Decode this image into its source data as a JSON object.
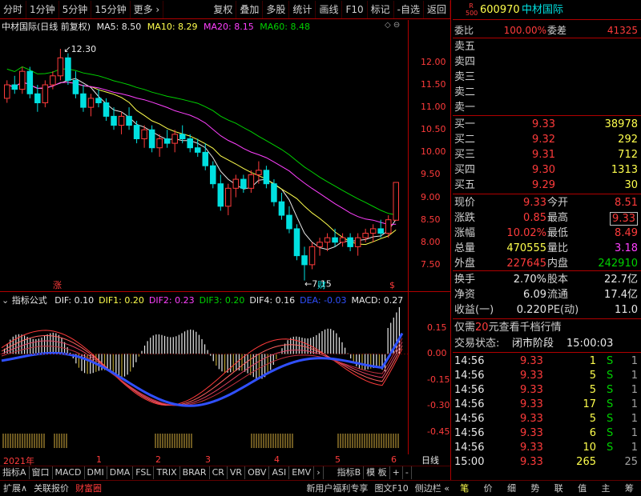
{
  "toolbar": {
    "left_items": [
      "分时",
      "1分钟",
      "5分钟",
      "15分钟",
      "更多 ›"
    ],
    "right_items": [
      "复权",
      "叠加",
      "多股",
      "统计",
      "画线",
      "F10",
      "标记",
      "-自选",
      "返回"
    ]
  },
  "chart": {
    "stock_label": "中材国际(日线 前复权)",
    "ma_legend": [
      {
        "label": "MA5: 8.50",
        "color": "#e8e8e8"
      },
      {
        "label": "MA10: 8.29",
        "color": "#ffff4d"
      },
      {
        "label": "MA20: 8.15",
        "color": "#ff40ff"
      },
      {
        "label": "MA60: 8.48",
        "color": "#00d200"
      }
    ],
    "high_label": "12.30",
    "low_label": "7.15",
    "price_ticks": [
      "12.00",
      "11.50",
      "11.00",
      "10.50",
      "10.00",
      "9.50",
      "9.00",
      "8.50",
      "8.00",
      "7.50"
    ],
    "markers": [
      "涨",
      "财",
      "$"
    ],
    "candles": [
      [
        11.2,
        11.6,
        11.1,
        11.5
      ],
      [
        11.5,
        11.7,
        11.3,
        11.4
      ],
      [
        11.4,
        11.9,
        11.3,
        11.8
      ],
      [
        11.8,
        11.9,
        11.2,
        11.3
      ],
      [
        11.3,
        11.5,
        10.9,
        11.1
      ],
      [
        11.1,
        11.6,
        11.0,
        11.5
      ],
      [
        11.5,
        11.8,
        11.4,
        11.7
      ],
      [
        11.7,
        12.3,
        11.6,
        12.1
      ],
      [
        12.1,
        12.2,
        11.5,
        11.6
      ],
      [
        11.6,
        11.8,
        11.2,
        11.3
      ],
      [
        11.3,
        11.5,
        10.9,
        11.0
      ],
      [
        11.0,
        11.3,
        10.8,
        11.2
      ],
      [
        11.2,
        11.4,
        11.0,
        11.1
      ],
      [
        11.1,
        11.2,
        10.7,
        10.8
      ],
      [
        10.8,
        11.0,
        10.5,
        10.6
      ],
      [
        10.6,
        10.9,
        10.4,
        10.8
      ],
      [
        10.8,
        11.0,
        10.5,
        10.6
      ],
      [
        10.6,
        10.7,
        10.2,
        10.3
      ],
      [
        10.3,
        10.6,
        10.1,
        10.5
      ],
      [
        10.5,
        10.6,
        10.0,
        10.1
      ],
      [
        10.1,
        10.4,
        9.9,
        10.3
      ],
      [
        10.3,
        10.5,
        10.1,
        10.2
      ],
      [
        10.2,
        10.5,
        10.0,
        10.4
      ],
      [
        10.4,
        10.6,
        10.2,
        10.3
      ],
      [
        10.3,
        10.4,
        10.0,
        10.1
      ],
      [
        10.1,
        10.3,
        9.9,
        10.0
      ],
      [
        10.0,
        10.2,
        9.6,
        9.7
      ],
      [
        9.7,
        9.8,
        9.2,
        9.3
      ],
      [
        9.3,
        9.5,
        8.7,
        8.8
      ],
      [
        8.8,
        9.3,
        8.6,
        9.2
      ],
      [
        9.2,
        9.5,
        9.0,
        9.4
      ],
      [
        9.4,
        9.5,
        9.1,
        9.2
      ],
      [
        9.2,
        9.6,
        9.1,
        9.5
      ],
      [
        9.5,
        9.8,
        9.3,
        9.6
      ],
      [
        9.6,
        9.7,
        9.2,
        9.3
      ],
      [
        9.3,
        9.4,
        8.8,
        8.9
      ],
      [
        8.9,
        9.1,
        8.5,
        8.6
      ],
      [
        8.6,
        8.8,
        8.2,
        8.3
      ],
      [
        8.3,
        8.4,
        7.6,
        7.7
      ],
      [
        7.7,
        7.9,
        7.15,
        7.5
      ],
      [
        7.5,
        8.0,
        7.4,
        7.9
      ],
      [
        7.9,
        8.1,
        7.7,
        8.0
      ],
      [
        8.0,
        8.2,
        7.8,
        8.1
      ],
      [
        8.1,
        8.3,
        7.9,
        8.0
      ],
      [
        8.0,
        8.2,
        7.9,
        8.1
      ],
      [
        8.1,
        8.2,
        7.8,
        7.9
      ],
      [
        7.9,
        8.2,
        7.7,
        8.1
      ],
      [
        8.1,
        8.3,
        8.0,
        8.2
      ],
      [
        8.2,
        8.4,
        8.0,
        8.3
      ],
      [
        8.3,
        8.5,
        8.1,
        8.2
      ],
      [
        8.2,
        8.6,
        8.1,
        8.5
      ],
      [
        8.49,
        9.33,
        8.49,
        9.33
      ]
    ],
    "indicator_label": "指标公式",
    "indicator_legend": [
      {
        "label": "DIF: 0.10",
        "color": "#e8e8e8"
      },
      {
        "label": "DIF1: 0.20",
        "color": "#ffff4d"
      },
      {
        "label": "DIF2: 0.23",
        "color": "#ff40ff"
      },
      {
        "label": "DIF3: 0.20",
        "color": "#00d200"
      },
      {
        "label": "DIF4: 0.16",
        "color": "#e8e8e8"
      },
      {
        "label": "DEA: -0.03",
        "color": "#3050ff"
      },
      {
        "label": "MACD: 0.27",
        "color": "#e8e8e8"
      }
    ],
    "indicator_ticks": [
      "0.15",
      "0.00",
      "-0.15",
      "-0.30",
      "-0.45"
    ],
    "date_labels": [
      "2021年",
      "1",
      "2",
      "3",
      "4",
      "5",
      "6"
    ],
    "period_label": "日线"
  },
  "indicator_tabs": [
    "指标A",
    "窗口",
    "MACD",
    "DMI",
    "DMA",
    "FSL",
    "TRIX",
    "BRAR",
    "CR",
    "VR",
    "OBV",
    "ASI",
    "EMV",
    "›",
    "指标B",
    "模 板",
    "+",
    "-"
  ],
  "bottom_bar": {
    "left": [
      "扩展∧",
      "关联报价",
      "财富圈"
    ],
    "right": [
      "新用户福利专享",
      "图文F10",
      "侧边栏 «"
    ],
    "tabs": [
      "笔",
      "价",
      "细",
      "势",
      "联",
      "值",
      "主",
      "筹"
    ]
  },
  "quote": {
    "code_badge": "R 500",
    "code": "600970",
    "name": "中材国际",
    "weibi_label": "委比",
    "weibi": "100.00%",
    "weicha_label": "委差",
    "weicha": "41325",
    "sell": [
      {
        "label": "卖五",
        "price": "",
        "vol": ""
      },
      {
        "label": "卖四",
        "price": "",
        "vol": ""
      },
      {
        "label": "卖三",
        "price": "",
        "vol": ""
      },
      {
        "label": "卖二",
        "price": "",
        "vol": ""
      },
      {
        "label": "卖一",
        "price": "",
        "vol": ""
      }
    ],
    "buy": [
      {
        "label": "买一",
        "price": "9.33",
        "vol": "38978"
      },
      {
        "label": "买二",
        "price": "9.32",
        "vol": "292"
      },
      {
        "label": "买三",
        "price": "9.31",
        "vol": "712"
      },
      {
        "label": "买四",
        "price": "9.30",
        "vol": "1313"
      },
      {
        "label": "买五",
        "price": "9.29",
        "vol": "30"
      }
    ],
    "stats": [
      {
        "l1": "现价",
        "v1": "9.33",
        "c1": "#ff3b3b",
        "l2": "今开",
        "v2": "8.51",
        "c2": "#ff3b3b"
      },
      {
        "l1": "涨跌",
        "v1": "0.85",
        "c1": "#ff3b3b",
        "l2": "最高",
        "v2": "9.33",
        "c2": "#ff3b3b"
      },
      {
        "l1": "涨幅",
        "v1": "10.02%",
        "c1": "#ff3b3b",
        "l2": "最低",
        "v2": "8.49",
        "c2": "#ff3b3b"
      },
      {
        "l1": "总量",
        "v1": "470555",
        "c1": "#ffff4d",
        "l2": "量比",
        "v2": "3.18",
        "c2": "#ff40ff"
      },
      {
        "l1": "外盘",
        "v1": "227645",
        "c1": "#ff3b3b",
        "l2": "内盘",
        "v2": "242910",
        "c2": "#00d200"
      }
    ],
    "fin": [
      {
        "l1": "换手",
        "v1": "2.70%",
        "l2": "股本",
        "v2": "22.7亿"
      },
      {
        "l1": "净资",
        "v1": "6.09",
        "l2": "流通",
        "v2": "17.4亿"
      },
      {
        "l1": "收益(一)",
        "v1": "0.220",
        "l2": "PE(动)",
        "v2": "11.0"
      }
    ],
    "promo_pre": "仅需",
    "promo_num": "20",
    "promo_post": "元查看千档行情",
    "status_label": "交易状态:",
    "status": "闭市阶段",
    "status_time": "15:00:03",
    "ticks": [
      {
        "time": "14:56",
        "price": "9.33",
        "vol": "1",
        "side": "S",
        "n": "1"
      },
      {
        "time": "14:56",
        "price": "9.33",
        "vol": "5",
        "side": "S",
        "n": "1"
      },
      {
        "time": "14:56",
        "price": "9.33",
        "vol": "5",
        "side": "S",
        "n": "1"
      },
      {
        "time": "14:56",
        "price": "9.33",
        "vol": "17",
        "side": "S",
        "n": "1"
      },
      {
        "time": "14:56",
        "price": "9.33",
        "vol": "5",
        "side": "S",
        "n": "1"
      },
      {
        "time": "14:56",
        "price": "9.33",
        "vol": "6",
        "side": "S",
        "n": "1"
      },
      {
        "time": "14:56",
        "price": "9.33",
        "vol": "10",
        "side": "S",
        "n": "1"
      },
      {
        "time": "15:00",
        "price": "9.33",
        "vol": "265",
        "side": "",
        "n": "25"
      }
    ]
  }
}
